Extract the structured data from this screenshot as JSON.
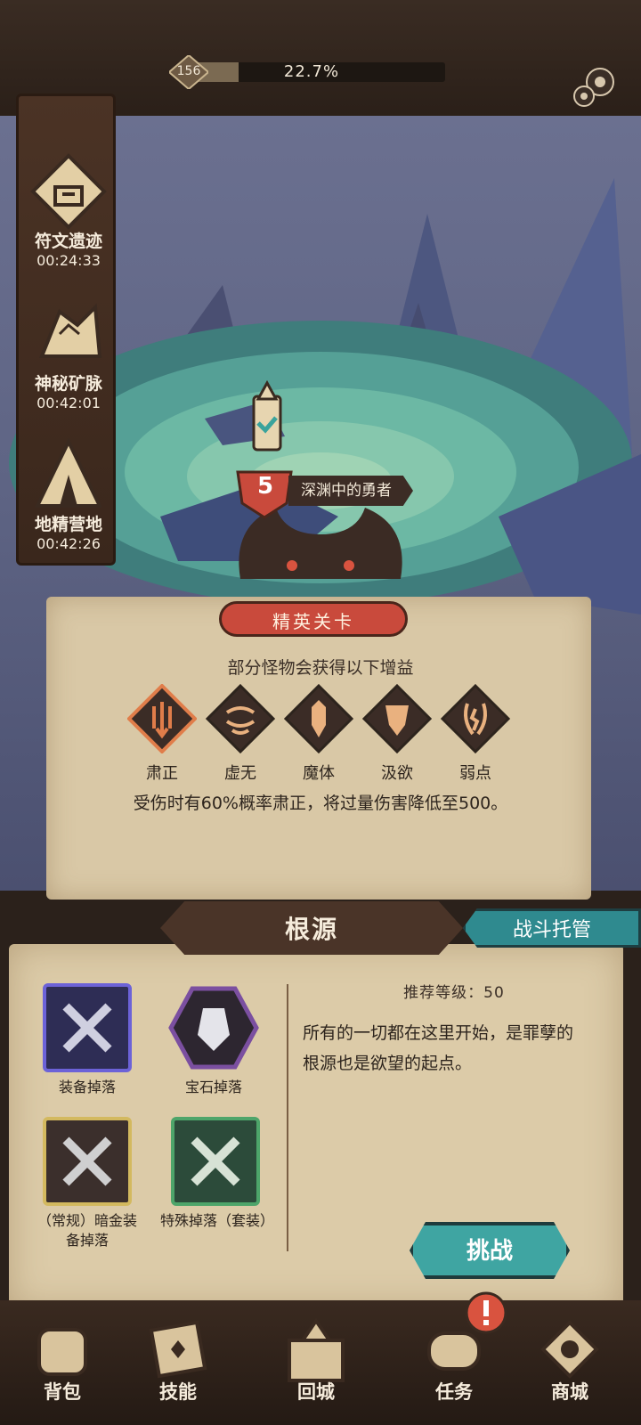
{
  "top": {
    "level": "156",
    "xp_percent_text": "22.7%",
    "xp_fraction": 0.227
  },
  "sidebar": {
    "sites": [
      {
        "name": "符文遗迹",
        "timer": "00:24:33",
        "icon": "rune-ruins-icon"
      },
      {
        "name": "神秘矿脉",
        "timer": "00:42:01",
        "icon": "mystic-vein-icon"
      },
      {
        "name": "地精营地",
        "timer": "00:42:26",
        "icon": "goblin-camp-icon"
      }
    ]
  },
  "stage": {
    "number": "5",
    "name": "深渊中的勇者"
  },
  "elite": {
    "tab_label": "精英关卡",
    "subtitle": "部分怪物会获得以下增益",
    "buffs": [
      {
        "label": "肃正",
        "icon": "justice-icon"
      },
      {
        "label": "虚无",
        "icon": "void-icon"
      },
      {
        "label": "魔体",
        "icon": "demon-body-icon"
      },
      {
        "label": "汲欲",
        "icon": "absorb-desire-icon"
      },
      {
        "label": "弱点",
        "icon": "weakness-icon"
      }
    ],
    "selected_description": "受伤时有60%概率肃正，将过量伤害降低至500。"
  },
  "panel": {
    "title": "根源",
    "auto_battle_label": "战斗托管",
    "recommended_level": "推荐等级：50",
    "description": "所有的一切都在这里开始，是罪孽的根源也是欲望的起点。",
    "challenge_label": "挑战",
    "drops": [
      {
        "label": "装备掉落",
        "icon": "equipment-drop-icon"
      },
      {
        "label": "宝石掉落",
        "icon": "gem-drop-icon"
      },
      {
        "label": "（常规）暗金装备掉落",
        "icon": "dark-gold-drop-icon"
      },
      {
        "label": "特殊掉落（套装）",
        "icon": "special-set-drop-icon"
      }
    ]
  },
  "nav": {
    "items": [
      {
        "label": "背包",
        "icon": "backpack-icon"
      },
      {
        "label": "技能",
        "icon": "skills-icon"
      },
      {
        "label": "回城",
        "icon": "town-icon"
      },
      {
        "label": "任务",
        "icon": "quest-icon"
      },
      {
        "label": "商城",
        "icon": "shop-icon"
      }
    ]
  },
  "colors": {
    "elite_red": "#c94a3c",
    "teal_button": "#3fa5a2",
    "parchment": "#d9c8a6"
  }
}
